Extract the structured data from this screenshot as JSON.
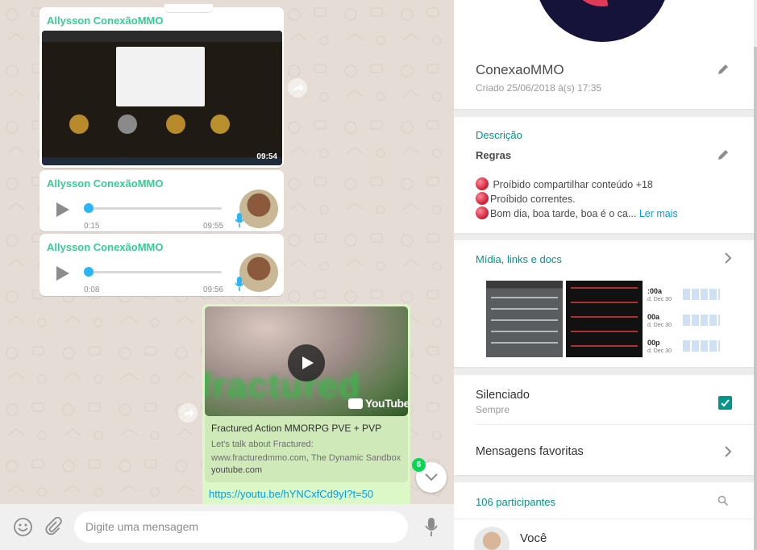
{
  "chat": {
    "messages": [
      {
        "type": "image",
        "sender": "Allysson ConexãoMMO",
        "duration": "09:54"
      },
      {
        "type": "voice",
        "sender": "Allysson ConexãoMMO",
        "elapsed": "0:15",
        "length": "09:55",
        "progress": 0
      },
      {
        "type": "voice",
        "sender": "Allysson ConexãoMMO",
        "elapsed": "0:08",
        "length": "09:56",
        "progress": 0
      },
      {
        "type": "link",
        "thumbnail_word": "fractured",
        "thumbnail_brand": "YouTube",
        "title": "Fractured Action MMORPG PVE + PVP",
        "description": "Let's talk about Fractured: www.fracturedmmo.com, The Dynamic Sandbox",
        "domain": "youtube.com",
        "url": "https://youtu.be/hYNCxfCd9yI?t=50"
      }
    ],
    "unread_count": "6"
  },
  "composer": {
    "placeholder": "Digite uma mensagem",
    "icons": [
      "emoji-icon",
      "paperclip-icon",
      "microphone-icon"
    ]
  },
  "info": {
    "group_name": "ConexaoMMO",
    "created": "Criado 25/06/2018 à(s) 17:35",
    "description_label": "Descrição",
    "rules_title": "Regras",
    "rules": [
      " Proíbido compartilhar conteúdo +18",
      "Proíbido correntes.",
      "Bom dia, boa tarde, boa é o ca..."
    ],
    "read_more": "Ler mais",
    "media_label": "Mídia, links e docs",
    "media_calendar": [
      {
        "time": ":00a",
        "day": "d, Dec 30"
      },
      {
        "time": "00a",
        "day": "d, Dec 30"
      },
      {
        "time": "00p",
        "day": "d, Dec 30"
      }
    ],
    "muted_label": "Silenciado",
    "muted_value": "Sempre",
    "muted_checked": true,
    "favorites_label": "Mensagens favoritas",
    "participants_label": "106 participantes",
    "me_label": "Você"
  },
  "colors": {
    "accent": "#009688",
    "sender": "#35cd96",
    "link": "#039be5",
    "outgoing_bubble": "#dcf8c6",
    "chat_background": "#e5ddd5",
    "badge": "#06d755"
  }
}
